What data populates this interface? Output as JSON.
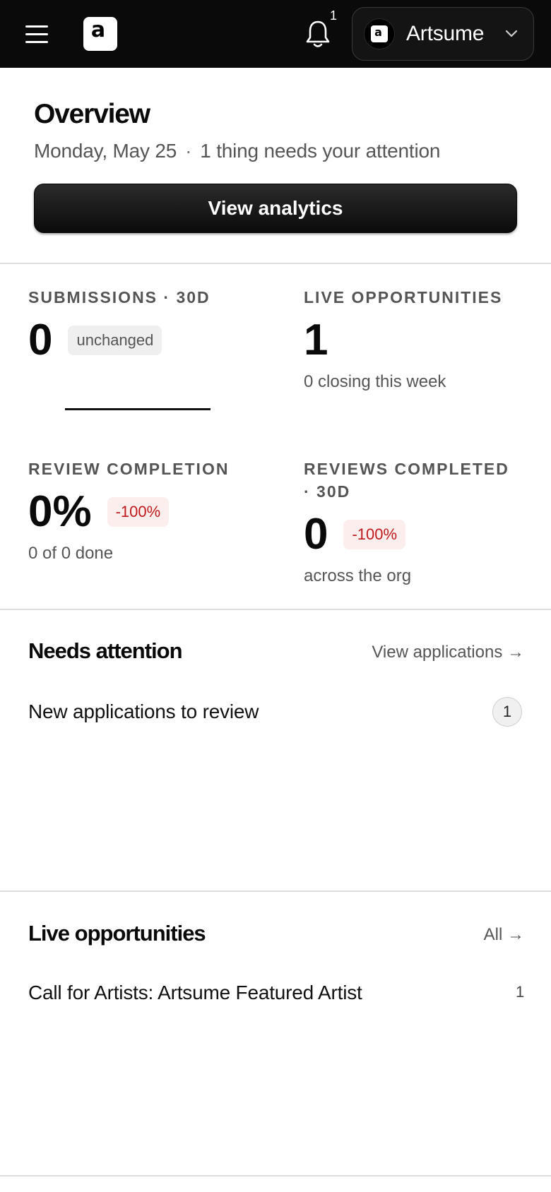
{
  "header": {
    "logo_letter": "a",
    "notification_count": "1",
    "org": {
      "avatar_letter": "a",
      "name": "Artsume"
    }
  },
  "overview": {
    "title": "Overview",
    "date": "Monday, May 25",
    "separator": "·",
    "attention_text": "1 thing needs your attention",
    "analytics_button": "View analytics"
  },
  "stats": {
    "submissions": {
      "label": "SUBMISSIONS · 30D",
      "value": "0",
      "badge": "unchanged"
    },
    "live_opportunities": {
      "label": "LIVE OPPORTUNITIES",
      "value": "1",
      "sub": "0 closing this week"
    },
    "review_completion": {
      "label": "REVIEW COMPLETION",
      "value": "0%",
      "badge": "-100%",
      "sub": "0 of 0 done"
    },
    "reviews_completed": {
      "label_line1": "REVIEWS COMPLETED",
      "label_line2": "· 30D",
      "value": "0",
      "badge": "-100%",
      "sub": "across the org"
    }
  },
  "needs_attention": {
    "title": "Needs attention",
    "link": "View applications →",
    "items": [
      {
        "label": "New applications to review",
        "count": "1"
      }
    ]
  },
  "live_opportunities": {
    "title": "Live opportunities",
    "link": "All →",
    "items": [
      {
        "label": "Call for Artists: Artsume Featured Artist",
        "count": "1"
      }
    ]
  },
  "colors": {
    "header_bg": "#0a0a0a",
    "negative": "#c0191c",
    "negative_bg": "#fdeeee",
    "muted_text": "#555555"
  }
}
